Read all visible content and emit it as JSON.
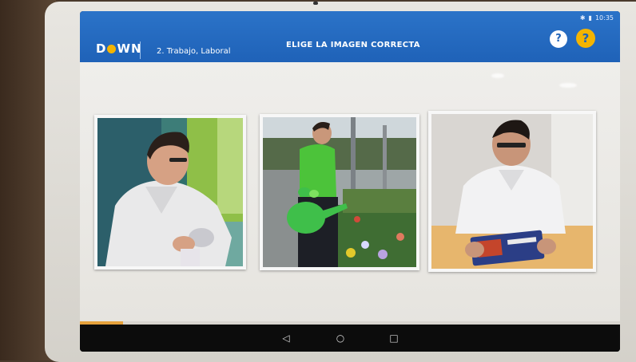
{
  "status": {
    "time": "10:35"
  },
  "header": {
    "logo": "DOWN",
    "section": "2. Trabajo, Laboral",
    "title": "ELIGE LA IMAGEN CORRECTA",
    "ear_icon": "ear-icon",
    "help_label": "?"
  },
  "options": [
    {
      "id": "lab-worker-gloves",
      "icon": "photo"
    },
    {
      "id": "gardener-watering",
      "icon": "photo"
    },
    {
      "id": "lab-worker-reading",
      "icon": "photo"
    }
  ],
  "progress": {
    "fraction": 0.08
  },
  "nav": {
    "back": "◁",
    "home": "○",
    "recents": "□"
  },
  "colors": {
    "appbar": "#2b73c8",
    "accent": "#f4b400",
    "progress": "#e6a23c"
  }
}
